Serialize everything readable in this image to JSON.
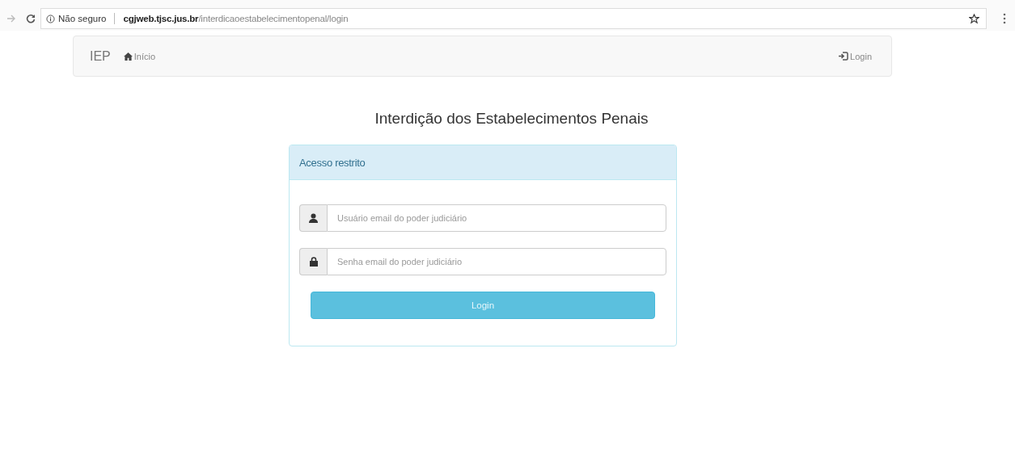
{
  "browser": {
    "not_secure": "Não seguro",
    "url": "**cgjweb.tjsc.jus.br**/interdicaoestabelecimentopenal/login"
  },
  "navbar": {
    "brand": "IEP",
    "links": [
      {
        "label": "Início"
      }
    ],
    "right_link": {
      "label": "Login"
    }
  },
  "title": "Interdição dos Estabelecimentos Penais",
  "panel": {
    "heading": "Acesso restrito",
    "fields": [
      {
        "kind": "username",
        "placeholder": "Usuário email do poder judiciário"
      },
      {
        "kind": "password",
        "placeholder": "Senha email do poder judiciário"
      }
    ],
    "button": "Login"
  }
}
